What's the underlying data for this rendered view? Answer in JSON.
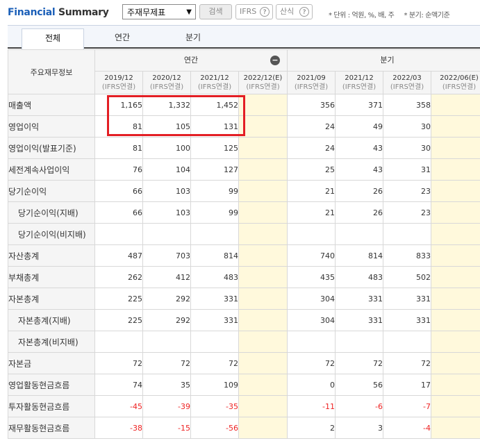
{
  "header": {
    "title_part1": "Financial",
    "title_part2": "Summary",
    "select_value": "주재무제표",
    "search_label": "검색",
    "ifrs_label": "IFRS",
    "calc_label": "산식",
    "help_glyph": "?",
    "unit_note": "* 단위 : 억원, %, 배, 주",
    "period_note": "* 분기: 순액기준"
  },
  "tabs": [
    "전체",
    "연간",
    "분기"
  ],
  "table": {
    "row_header_title": "주요재무정보",
    "group_annual": "연간",
    "group_quarter": "분기",
    "collapse_glyph": "−",
    "periods": [
      {
        "date": "2019/12",
        "basis": "(IFRS연결)"
      },
      {
        "date": "2020/12",
        "basis": "(IFRS연결)"
      },
      {
        "date": "2021/12",
        "basis": "(IFRS연결)"
      },
      {
        "date": "2022/12(E)",
        "basis": "(IFRS연결)"
      },
      {
        "date": "2021/09",
        "basis": "(IFRS연결)"
      },
      {
        "date": "2021/12",
        "basis": "(IFRS연결)"
      },
      {
        "date": "2022/03",
        "basis": "(IFRS연결)"
      },
      {
        "date": "2022/06(E)",
        "basis": "(IFRS연결)"
      }
    ],
    "rows": [
      {
        "label": "매출액",
        "indent": false,
        "values": [
          "1,165",
          "1,332",
          "1,452",
          "",
          "356",
          "371",
          "358",
          ""
        ]
      },
      {
        "label": "영업이익",
        "indent": false,
        "values": [
          "81",
          "105",
          "131",
          "",
          "24",
          "49",
          "30",
          ""
        ]
      },
      {
        "label": "영업이익(발표기준)",
        "indent": false,
        "values": [
          "81",
          "100",
          "125",
          "",
          "24",
          "43",
          "30",
          ""
        ]
      },
      {
        "label": "세전계속사업이익",
        "indent": false,
        "values": [
          "76",
          "104",
          "127",
          "",
          "25",
          "43",
          "31",
          ""
        ]
      },
      {
        "label": "당기순이익",
        "indent": false,
        "values": [
          "66",
          "103",
          "99",
          "",
          "21",
          "26",
          "23",
          ""
        ]
      },
      {
        "label": "당기순이익(지배)",
        "indent": true,
        "values": [
          "66",
          "103",
          "99",
          "",
          "21",
          "26",
          "23",
          ""
        ]
      },
      {
        "label": "당기순이익(비지배)",
        "indent": true,
        "values": [
          "",
          "",
          "",
          "",
          "",
          "",
          "",
          ""
        ]
      },
      {
        "label": "자산총계",
        "indent": false,
        "values": [
          "487",
          "703",
          "814",
          "",
          "740",
          "814",
          "833",
          ""
        ]
      },
      {
        "label": "부채총계",
        "indent": false,
        "values": [
          "262",
          "412",
          "483",
          "",
          "435",
          "483",
          "502",
          ""
        ]
      },
      {
        "label": "자본총계",
        "indent": false,
        "values": [
          "225",
          "292",
          "331",
          "",
          "304",
          "331",
          "331",
          ""
        ]
      },
      {
        "label": "자본총계(지배)",
        "indent": true,
        "values": [
          "225",
          "292",
          "331",
          "",
          "304",
          "331",
          "331",
          ""
        ]
      },
      {
        "label": "자본총계(비지배)",
        "indent": true,
        "values": [
          "",
          "",
          "",
          "",
          "",
          "",
          "",
          ""
        ]
      },
      {
        "label": "자본금",
        "indent": false,
        "values": [
          "72",
          "72",
          "72",
          "",
          "72",
          "72",
          "72",
          ""
        ]
      },
      {
        "label": "영업활동현금흐름",
        "indent": false,
        "values": [
          "74",
          "35",
          "109",
          "",
          "0",
          "56",
          "17",
          ""
        ]
      },
      {
        "label": "투자활동현금흐름",
        "indent": false,
        "values": [
          "-45",
          "-39",
          "-35",
          "",
          "-11",
          "-6",
          "-7",
          ""
        ]
      },
      {
        "label": "재무활동현금흐름",
        "indent": false,
        "values": [
          "-38",
          "-15",
          "-56",
          "",
          "2",
          "3",
          "-4",
          ""
        ]
      }
    ]
  },
  "colors": {
    "brand_blue": "#1b5fb8",
    "negative": "#e22222",
    "estimate_bg": "#fff9dc",
    "highlight": "#e31e24"
  }
}
